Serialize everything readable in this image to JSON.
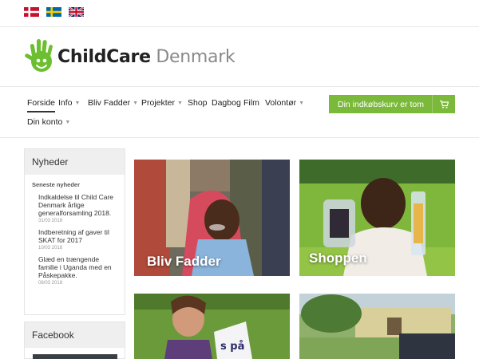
{
  "languages": [
    {
      "name": "Dansk",
      "flag": "denmark-flag-icon"
    },
    {
      "name": "Svenska",
      "flag": "sweden-flag-icon"
    },
    {
      "name": "English",
      "flag": "uk-flag-icon"
    }
  ],
  "logo": {
    "bold": "ChildCare",
    "light": "Denmark"
  },
  "nav": {
    "items": [
      {
        "label": "Forside",
        "caret": false,
        "active": true
      },
      {
        "label": "Info",
        "caret": true
      },
      {
        "label": "Bliv Fadder",
        "caret": true
      },
      {
        "label": "Projekter",
        "caret": true
      },
      {
        "label": "Shop",
        "caret": false
      },
      {
        "label": "Dagbog",
        "caret": false
      },
      {
        "label": "Film",
        "caret": false
      },
      {
        "label": "Volontør",
        "caret": true
      },
      {
        "label": "Din konto",
        "caret": true
      }
    ],
    "cart_label": "Din indkøbskurv er tom"
  },
  "sidebar": {
    "news_title": "Nyheder",
    "latest_label": "Seneste nyheder",
    "news": [
      {
        "title": "Indkaldelse til Child Care Denmark årlige generalforsamling 2018.",
        "date": "31/03 2018"
      },
      {
        "title": "Indberetning af gaver til SKAT for 2017",
        "date": "10/03 2018"
      },
      {
        "title": "Glæd en trængende familie i Uganda med en Påskepakke.",
        "date": "08/03 2018"
      }
    ],
    "facebook_title": "Facebook"
  },
  "tiles": [
    {
      "title": "Bliv Fadder"
    },
    {
      "title": "Shoppen"
    },
    {
      "title": ""
    },
    {
      "title": ""
    }
  ],
  "colors": {
    "accent": "#7ab939",
    "logo_green": "#6cbf30"
  }
}
